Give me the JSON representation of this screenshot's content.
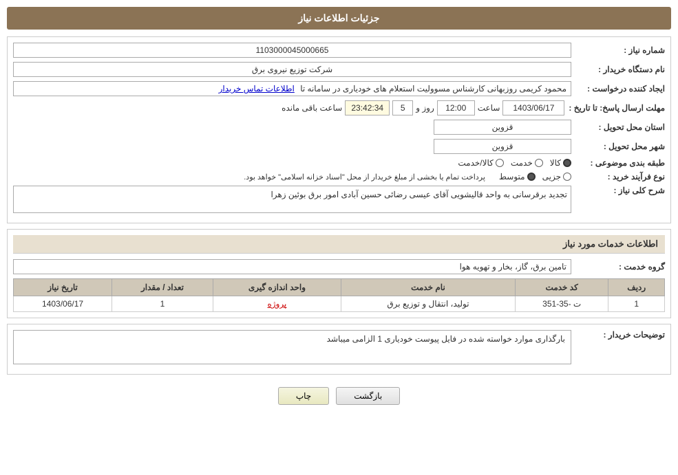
{
  "header": {
    "title": "جزئیات اطلاعات نیاز"
  },
  "form": {
    "shomara_label": "شماره نیاز :",
    "shomara_value": "1103000045000665",
    "nam_dastgah_label": "نام دستگاه خریدار :",
    "nam_dastgah_value": "شرکت توزیع نیروی برق",
    "ijad_konande_label": "ایجاد کننده درخواست :",
    "ijad_konande_value": "محمود کریمی روزبهانی کارشناس  مسوولیت استعلام های خودیاری در سامانه تا",
    "etelaat_link": "اطلاعات تماس خریدار",
    "mohlet_label": "مهلت ارسال پاسخ: تا تاریخ :",
    "mohlet_date": "1403/06/17",
    "mohlet_saat_label": "ساعت",
    "mohlet_saat": "12:00",
    "mohlet_roz_label": "روز و",
    "mohlet_roz": "5",
    "mohlet_countdown_label": "ساعت باقی مانده",
    "mohlet_countdown": "23:42:34",
    "ostan_label": "استان محل تحویل :",
    "ostan_value": "قزوین",
    "shahr_label": "شهر محل تحویل :",
    "shahr_value": "قزوین",
    "tabaqe_label": "طبقه بندی موضوعی :",
    "tabaqe_kala": "کالا",
    "tabaqe_khadamat": "خدمت",
    "tabaqe_kala_khadamat": "کالا/خدمت",
    "tabaqe_selected": "kala",
    "noeFarayand_label": "نوع فرآیند خرید :",
    "noeFarayand_jozi": "جزیی",
    "noeFarayand_motavaset": "متوسط",
    "noeFarayand_selected": "motavaset",
    "noeFarayand_note": "پرداخت تمام یا بخشی از مبلغ خریدار از محل \"اسناد خزانه اسلامی\" خواهد بود.",
    "sharh_label": "شرح کلی نیاز :",
    "sharh_value": "تجدید برقرسانی به واحد قالیشویی آقای عیسی رضائی حسین آبادی امور برق بوئین زهرا",
    "khadamat_section_title": "اطلاعات خدمات مورد نیاز",
    "gorohe_label": "گروه خدمت :",
    "gorohe_value": "تامین برق، گاز، بخار و تهویه هوا",
    "table_headers": [
      "ردیف",
      "کد خدمت",
      "نام خدمت",
      "واحد اندازه گیری",
      "تعداد / مقدار",
      "تاریخ نیاز"
    ],
    "table_rows": [
      {
        "radif": "1",
        "kod": "ت -35-351",
        "nam": "تولید، انتقال و توزیع برق",
        "vahed": "پروژه",
        "tedad": "1",
        "tarikh": "1403/06/17"
      }
    ],
    "towzih_label": "توضیحات خریدار :",
    "towzih_value": "بارگذاری موارد خواسته شده در فایل پیوست خودیاری 1 الزامی میباشد",
    "btn_chap": "چاپ",
    "btn_bazgasht": "بازگشت"
  }
}
